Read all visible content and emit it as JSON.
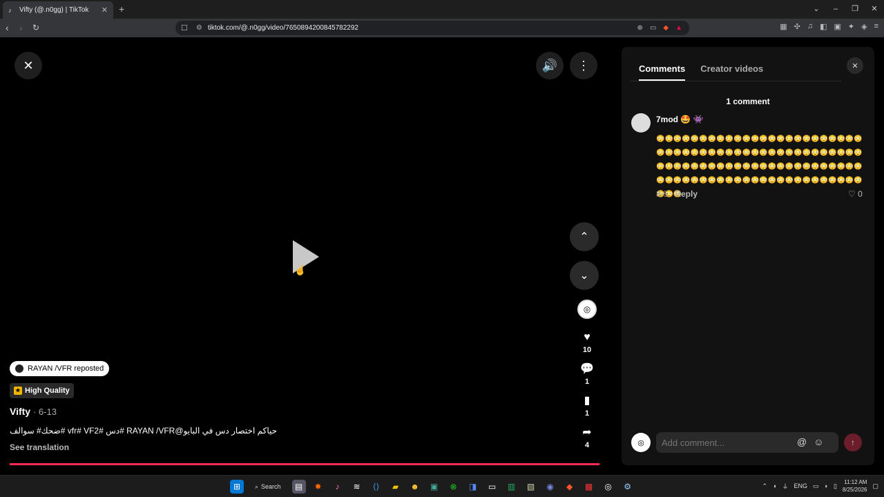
{
  "browser": {
    "tab_title": "Vifty (@.n0gg) | TikTok",
    "url": "tiktok.com/@.n0gg/video/7650894200845782292"
  },
  "video": {
    "reposted_by": "RAYAN /VFR reposted",
    "quality_label": "High Quality",
    "author": "Vifty",
    "date": "· 6-13",
    "caption": "ضحك# سوالف# vfr# VF2# دس# RAYAN /VFR@حياكم اختصار دس في البايو",
    "see_translation": "See translation",
    "likes": "10",
    "comments": "1",
    "saves": "1",
    "shares": "4",
    "progress": 1.0
  },
  "comments_panel": {
    "tabs": [
      "Comments",
      "Creator videos"
    ],
    "count_label": "1 comment",
    "comment": {
      "username": "7mod 🤩 👾",
      "text": "😳😳😳😳😳😳😳😳😳😳😳😳😳😳😳😳😳😳😳😳😳😳😳😳😳😳😳😳😳😳😳😳😳😳😳😳😳😳😳😳😳😳😳😳😳😳😳😳😳😳😳😳😳😳😳😳😳😳😳😳😳😳😳😳😳😳😳😳😳😳😳😳😳😳😳😳😳😳😳😳😳😳😳😳😳😳😳😳😳😳😳😳😳😳😳😳😳😳😳",
      "date": "8-5",
      "reply_label": "Reply",
      "likes": "0"
    },
    "input_placeholder": "Add comment..."
  },
  "taskbar": {
    "search_label": "Search",
    "language": "ENG",
    "time": "11:12 AM",
    "date": "8/25/2026"
  },
  "colors": {
    "accent": "#fe2c55",
    "panel_bg": "#121212"
  }
}
